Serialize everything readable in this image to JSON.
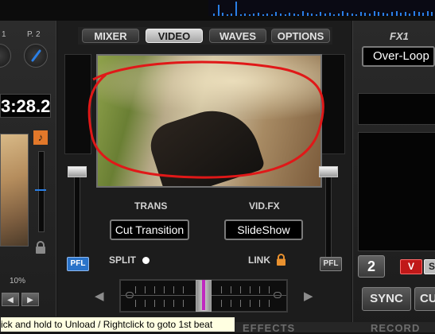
{
  "tabs": [
    {
      "label": "MIXER",
      "active": false
    },
    {
      "label": "VIDEO",
      "active": true
    },
    {
      "label": "WAVES",
      "active": false
    },
    {
      "label": "OPTIONS",
      "active": false
    }
  ],
  "left_deck": {
    "knob_label_1": "1",
    "knob_label_2": "P. 2",
    "time": "3:28.2",
    "pitch_percent": "10%",
    "key_icon_glyph": "♪",
    "arrow_left": "◀",
    "arrow_right": "▶"
  },
  "video": {
    "trans_label": "TRANS",
    "trans_value": "Cut Transition",
    "vidfx_label": "VID.FX",
    "vidfx_value": "SlideShow",
    "split_label": "SPLIT",
    "link_label": "LINK",
    "pfl_left": "PFL",
    "pfl_right": "PFL",
    "xfader_left_arrow": "◀",
    "xfader_right_arrow": "▶",
    "xfader_position": 0.5
  },
  "fx": {
    "title": "FX1",
    "selected": "Over-Loop"
  },
  "right_deck": {
    "deck_number": "2",
    "v_label": "V",
    "s_label": "S",
    "sync_label": "SYNC",
    "cue_label": "CUE"
  },
  "bottom_tabs": {
    "effects": "EFFECTS",
    "record": "RECORD"
  },
  "tooltip": "ick and hold to Unload / Rightclick to goto 1st beat",
  "colors": {
    "accent_blue": "#2a73c9",
    "annotation_red": "#e01818",
    "key_orange": "#e2782a",
    "xfader_marker": "#c028c0"
  }
}
